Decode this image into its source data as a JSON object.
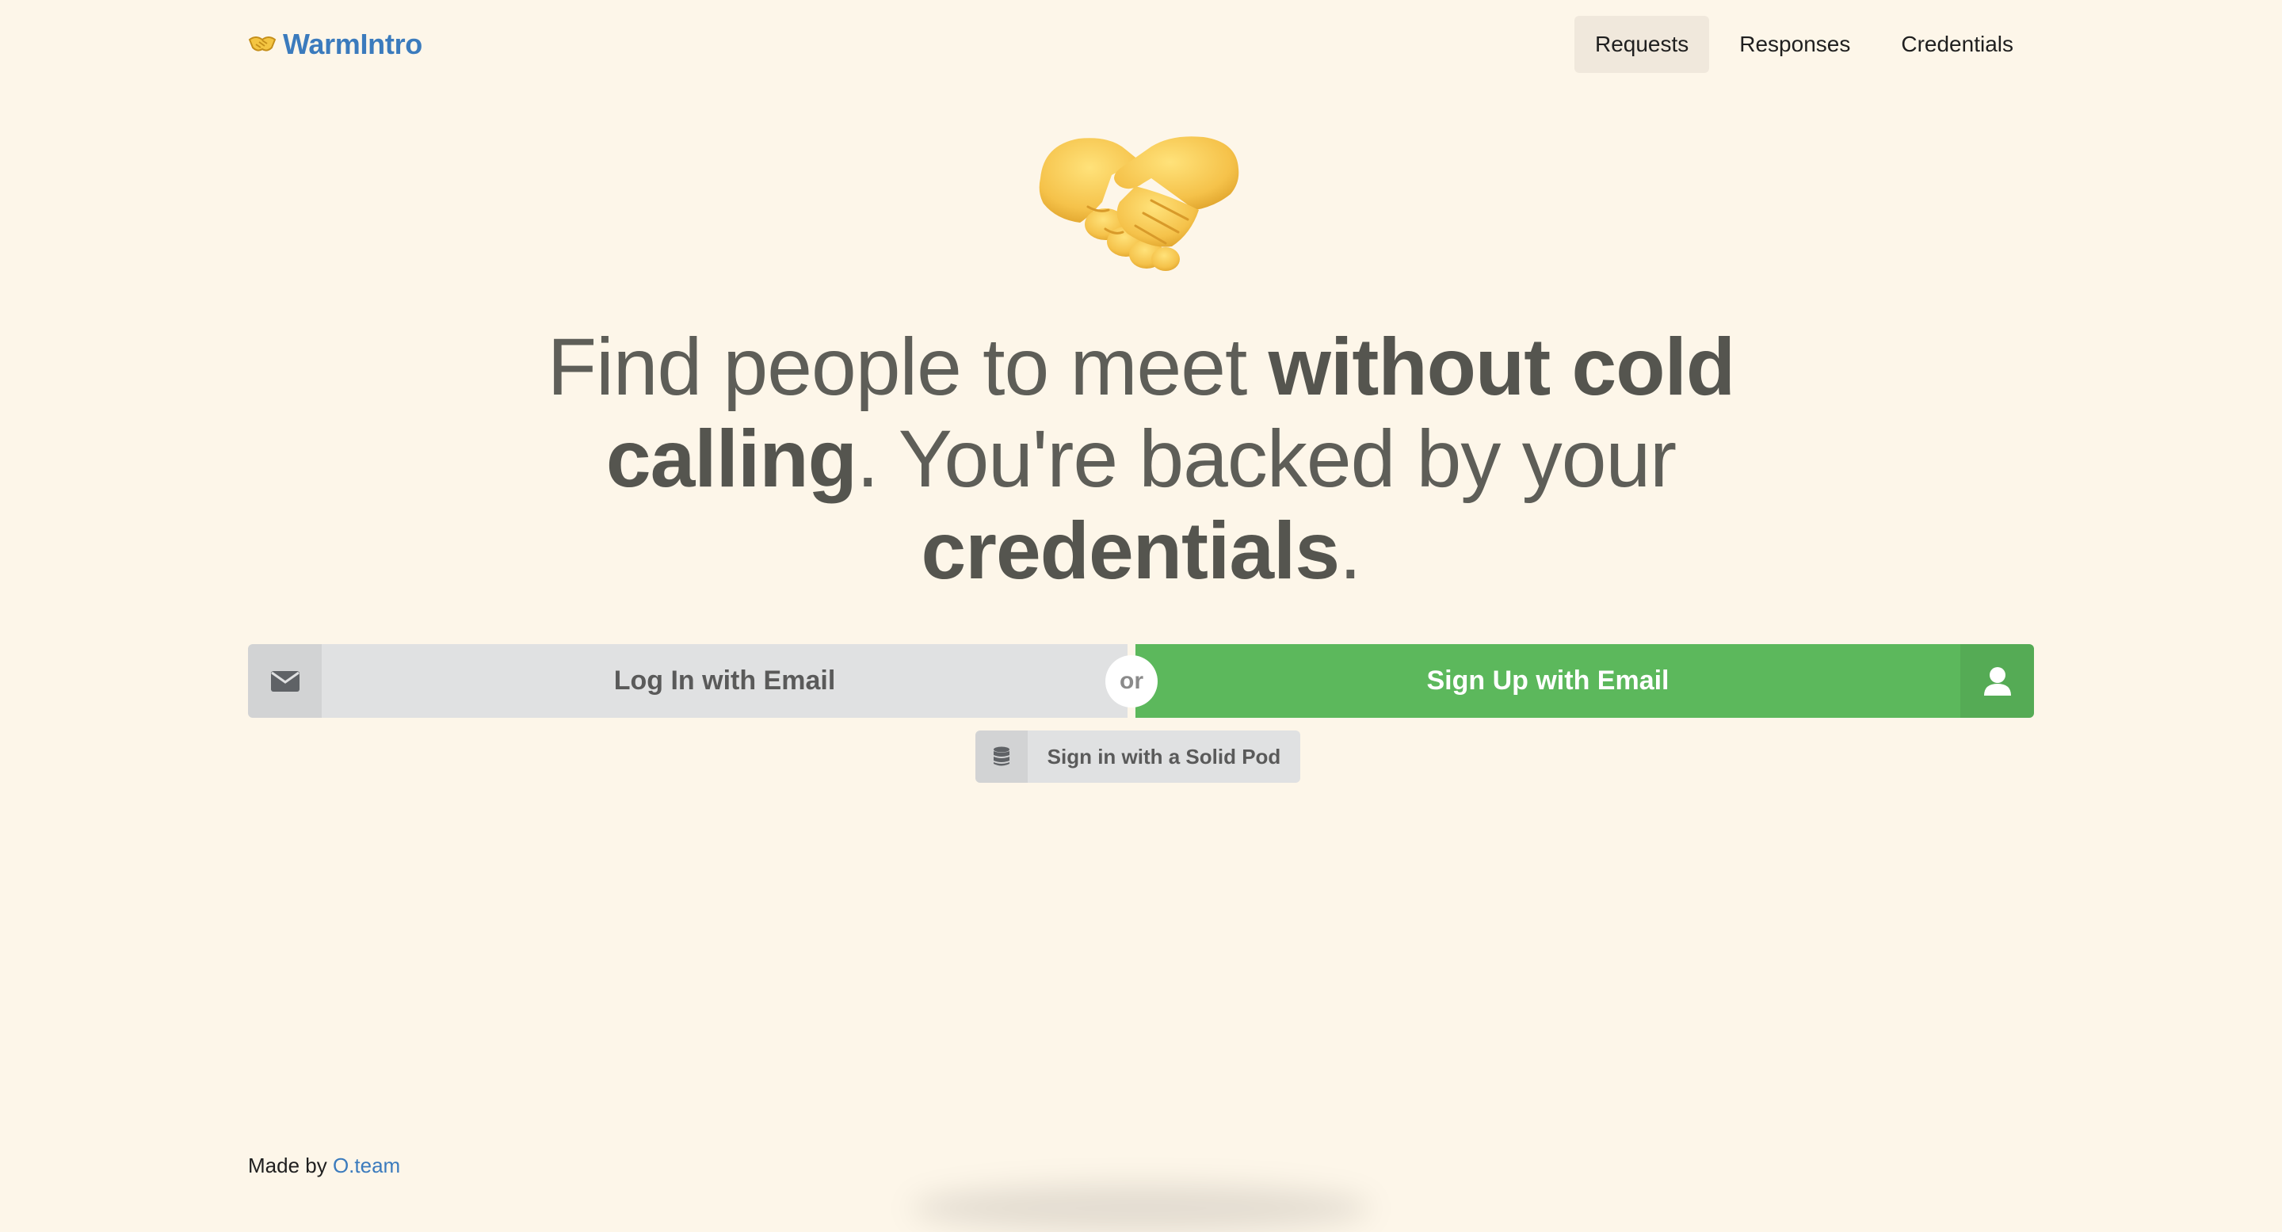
{
  "header": {
    "brand_name": "WarmIntro",
    "brand_icon": "handshake-icon",
    "nav": [
      {
        "label": "Requests",
        "active": true
      },
      {
        "label": "Responses",
        "active": false
      },
      {
        "label": "Credentials",
        "active": false
      }
    ]
  },
  "hero": {
    "icon": "handshake-emoji",
    "headline_part1": "Find people to meet ",
    "headline_bold1": "without cold calling",
    "headline_part2": ". You're backed by your ",
    "headline_bold2": "credentials",
    "headline_part3": "."
  },
  "auth": {
    "login_label": "Log In with Email",
    "login_icon": "envelope-icon",
    "or_label": "or",
    "signup_label": "Sign Up with Email",
    "signup_icon": "user-icon",
    "solid_label": "Sign in with a Solid Pod",
    "solid_icon": "database-icon"
  },
  "footer": {
    "prefix": "Made by ",
    "link_label": "O.team"
  },
  "colors": {
    "background": "#fdf6e9",
    "brand": "#3b7bbd",
    "signup_green": "#5cb85c",
    "button_grey": "#e0e1e2",
    "headline_text": "#5e5e58"
  }
}
